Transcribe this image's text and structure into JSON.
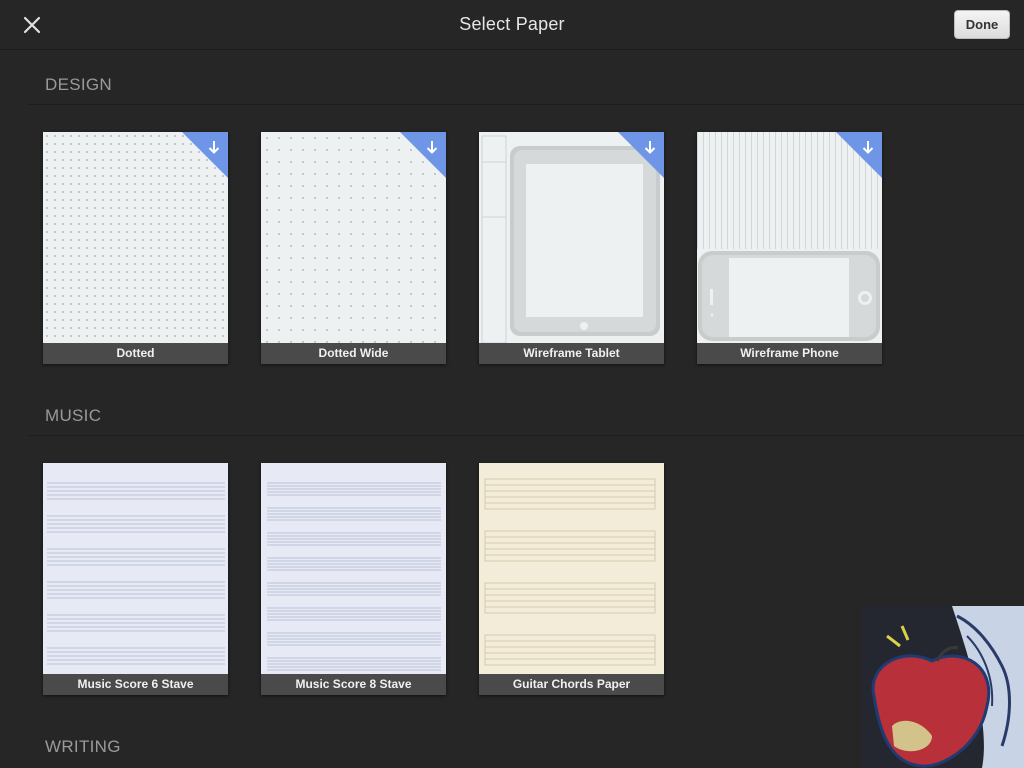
{
  "header": {
    "title": "Select Paper",
    "done_label": "Done"
  },
  "sections": {
    "design": {
      "title": "DESIGN",
      "items": [
        {
          "label": "Dotted",
          "downloadable": true
        },
        {
          "label": "Dotted Wide",
          "downloadable": true
        },
        {
          "label": "Wireframe Tablet",
          "downloadable": true
        },
        {
          "label": "Wireframe Phone",
          "downloadable": true
        }
      ]
    },
    "music": {
      "title": "MUSIC",
      "items": [
        {
          "label": "Music Score 6 Stave"
        },
        {
          "label": "Music Score 8 Stave"
        },
        {
          "label": "Guitar Chords Paper"
        }
      ]
    },
    "writing": {
      "title": "WRITING"
    }
  },
  "icons": {
    "close": "close-icon",
    "download": "download-arrow-icon"
  },
  "colors": {
    "background": "#262626",
    "badge": "#6f95e6",
    "label_bar": "#4a4a4a",
    "done_button": "#e8e8e8"
  }
}
